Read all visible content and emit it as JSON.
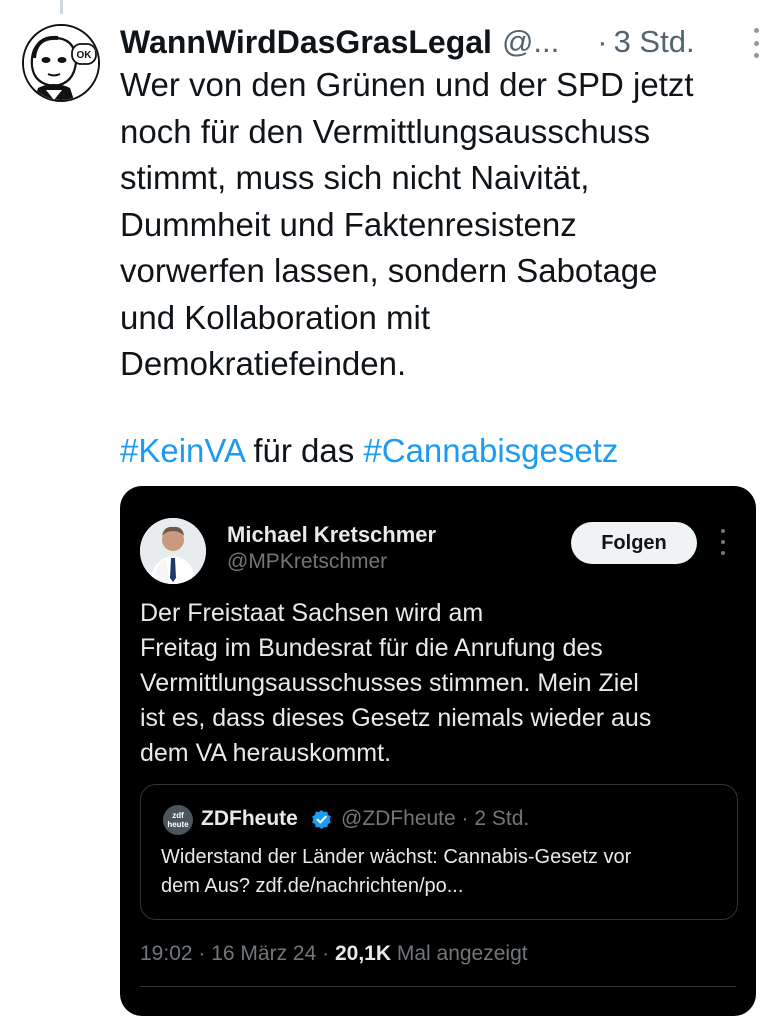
{
  "tweet": {
    "author_name": "WannWirdDasGrasLegal",
    "author_handle": "@...",
    "separator": "·",
    "time": "3 Std.",
    "text_lines": [
      "Wer von den Grünen und der SPD jetzt",
      "noch für den Vermittlungsausschuss",
      "stimmt, muss sich nicht Naivität,",
      "Dummheit und Faktenresistenz",
      "vorwerfen lassen, sondern Sabotage",
      "und Kollaboration mit",
      "Demokratiefeinden."
    ],
    "hashtag_1": "#KeinVA",
    "mid_text": " für das ",
    "hashtag_2": "#Cannabisgesetz",
    "avatar_badge": "OK"
  },
  "embedded": {
    "author_name": "Michael Kretschmer",
    "author_handle": "@MPKretschmer",
    "follow_label": "Folgen",
    "text_lines": [
      "Der Freistaat Sachsen wird am",
      "Freitag im Bundesrat für die Anrufung des",
      "Vermittlungsausschusses stimmen. Mein Ziel",
      "ist es, dass dieses Gesetz niemals wieder aus",
      "dem VA herauskommt."
    ],
    "quote": {
      "logo_top": "zdf",
      "logo_bottom": "heute",
      "name": "ZDFheute",
      "handle": "@ZDFheute",
      "separator": "·",
      "time": "2 Std.",
      "text_lines": [
        "Widerstand der Länder wächst: Cannabis-Gesetz vor",
        "dem Aus? zdf.de/nachrichten/po..."
      ]
    },
    "footer": {
      "time": "19:02",
      "sep1": " · ",
      "date": "16 März 24",
      "sep2": " · ",
      "views": "20,1K",
      "views_label": " Mal angezeigt"
    }
  },
  "colors": {
    "accent": "#1d9bf0",
    "secondary_text": "#536471",
    "card_bg": "#000000",
    "card_text": "#e7e9ea",
    "card_secondary": "#71767b"
  },
  "icons": [
    "more-options-icon",
    "verified-badge-icon"
  ]
}
